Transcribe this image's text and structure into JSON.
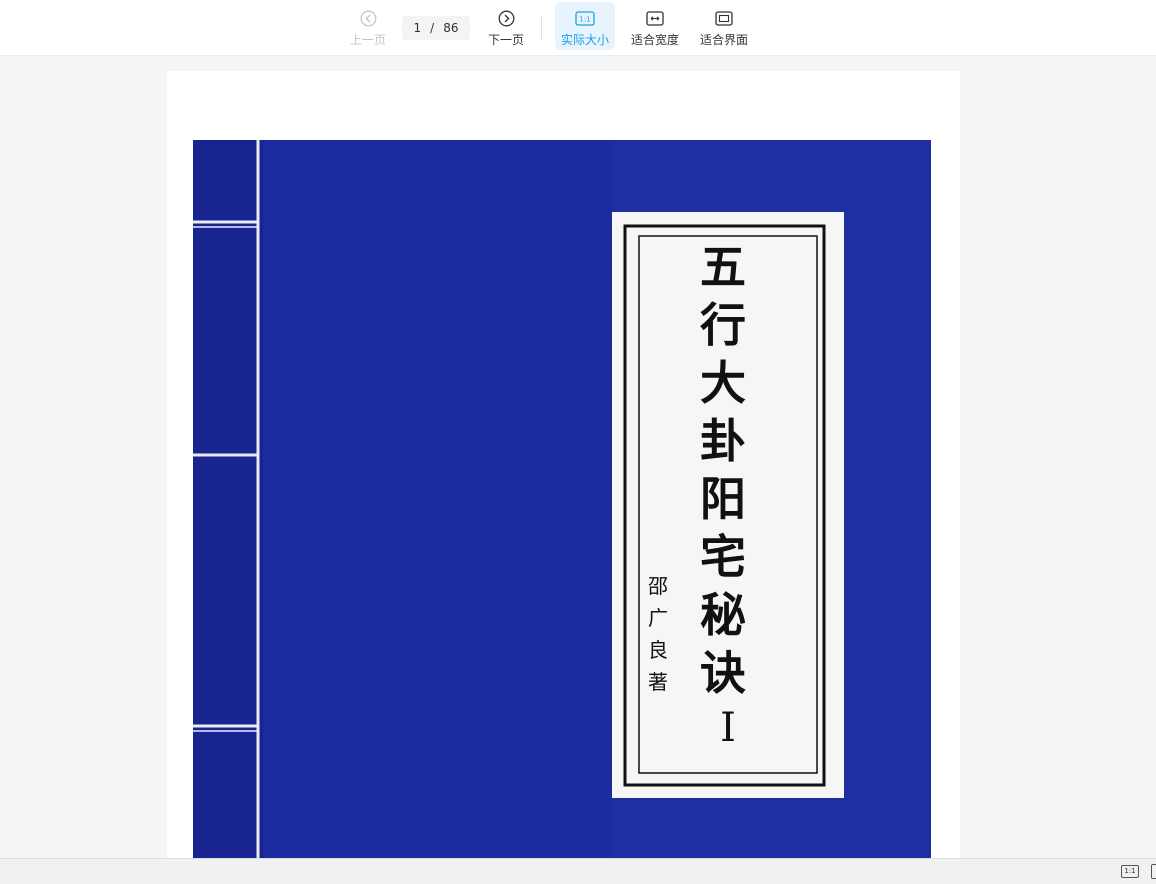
{
  "toolbar": {
    "prev_label": "上一页",
    "next_label": "下一页",
    "current_page": "1",
    "separator": "/",
    "total_pages": "86",
    "actual_size_label": "实际大小",
    "actual_size_icon_text": "1:1",
    "fit_width_label": "适合宽度",
    "fit_screen_label": "适合界面",
    "icons": [
      "chevron-left-circle-icon",
      "chevron-right-circle-icon",
      "actual-size-icon",
      "fit-width-icon",
      "fit-screen-icon"
    ]
  },
  "document": {
    "title_chars": [
      "五",
      "行",
      "大",
      "卦",
      "阳",
      "宅",
      "秘",
      "诀"
    ],
    "author_chars": [
      "邵",
      "广",
      "良",
      "著"
    ],
    "volume": "I"
  },
  "status_bar": {
    "zoom_badge": "1:1"
  },
  "colors": {
    "accent": "#1aa0e8",
    "active_bg": "#e8f4fd",
    "cover_blue": "#1c2b9f",
    "disabled": "#c2c6cc"
  }
}
